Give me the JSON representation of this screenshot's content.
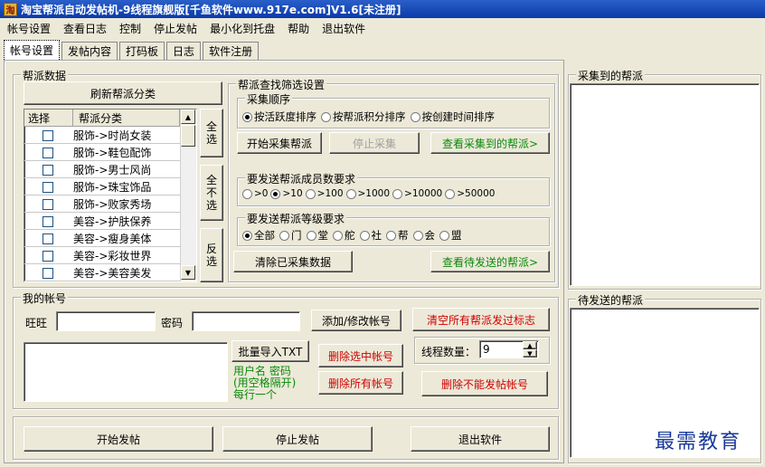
{
  "window": {
    "title": "淘宝帮派自动发帖机-9线程旗舰版[千鱼软件www.917e.com]V1.6[未注册]",
    "icon_text": "淘"
  },
  "menu": [
    "帐号设置",
    "查看日志",
    "控制",
    "停止发帖",
    "最小化到托盘",
    "帮助",
    "退出软件"
  ],
  "tabs": [
    "帐号设置",
    "发帖内容",
    "打码板",
    "日志",
    "软件注册"
  ],
  "bangpai_data": {
    "legend": "帮派数据",
    "refresh_button": "刷新帮派分类",
    "columns": [
      "选择",
      "帮派分类"
    ],
    "rows": [
      "服饰->时尚女装",
      "服饰->鞋包配饰",
      "服饰->男士风尚",
      "服饰->珠宝饰品",
      "服饰->败家秀场",
      "美容->护肤保养",
      "美容->瘦身美体",
      "美容->彩妆世界",
      "美容->美容美发"
    ],
    "select_all": [
      "全",
      "选"
    ],
    "select_none": [
      "全",
      "不",
      "选"
    ],
    "invert": [
      "反",
      "选"
    ]
  },
  "filter": {
    "legend": "帮派查找筛选设置",
    "order": {
      "legend": "采集顺序",
      "options": [
        "按活跃度排序",
        "按帮派积分排序",
        "按创建时间排序"
      ],
      "selected": 0
    },
    "start_collect": "开始采集帮派",
    "stop_collect": "停止采集",
    "view_collected": "查看采集到的帮派>",
    "members": {
      "legend": "要发送帮派成员数要求",
      "options": [
        ">0",
        ">10",
        ">100",
        ">1000",
        ">10000",
        ">50000"
      ],
      "selected": 1
    },
    "level": {
      "legend": "要发送帮派等级要求",
      "options": [
        "全部",
        "门",
        "堂",
        "舵",
        "社",
        "帮",
        "会",
        "盟"
      ],
      "selected": 0
    },
    "clear_collected": "清除已采集数据",
    "view_pending": "查看待发送的帮派>"
  },
  "collected_panel": {
    "legend": "采集到的帮派"
  },
  "pending_panel": {
    "legend": "待发送的帮派"
  },
  "account": {
    "legend": "我的帐号",
    "wangwang_label": "旺旺",
    "wangwang_value": "",
    "password_label": "密码",
    "password_value": "",
    "add_edit_button": "添加/修改帐号",
    "clear_flags_button": "清空所有帮派发过标志",
    "batch_import_button": "批量导入TXT",
    "import_hint": [
      "用户名 密码",
      "(用空格隔开)",
      "每行一个"
    ],
    "delete_selected_button": "删除选中帐号",
    "delete_all_button": "删除所有帐号",
    "thread_label": "线程数量：",
    "thread_value": "9",
    "delete_unable_button": "删除不能发帖帐号"
  },
  "bottom": {
    "start": "开始发帖",
    "stop": "停止发帖",
    "exit": "退出软件"
  },
  "watermark": "最需教育"
}
